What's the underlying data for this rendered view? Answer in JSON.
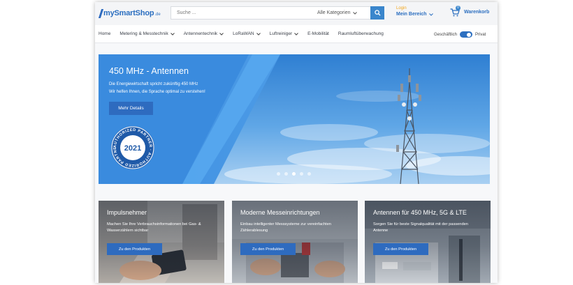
{
  "header": {
    "logo_text": "mySmartShop",
    "logo_tld": ".de",
    "search_placeholder": "Suche ...",
    "category_label": "Alle Kategorien",
    "login_label": "Login",
    "account_label": "Mein Bereich",
    "cart_label": "Warenkorb",
    "cart_count": "0"
  },
  "nav": {
    "items": [
      {
        "label": "Home",
        "dropdown": false
      },
      {
        "label": "Metering & Messtechnik",
        "dropdown": true
      },
      {
        "label": "Antennentechnik",
        "dropdown": true
      },
      {
        "label": "LoRaWAN",
        "dropdown": true
      },
      {
        "label": "Luftreiniger",
        "dropdown": true
      },
      {
        "label": "E-Mobilität",
        "dropdown": false
      },
      {
        "label": "Raumluftüberwachung",
        "dropdown": false
      }
    ],
    "toggle_left": "Geschäftlich",
    "toggle_right": "Privat"
  },
  "hero": {
    "title": "450 MHz - Antennen",
    "line1": "Die Energiewirtschaft spricht zukünftig 450 MHz",
    "line2": "Wir helfen Ihnen, die Sprache optimal zu verstehen!",
    "button": "Mehr Details",
    "seal_year": "2021",
    "seal_ring": "AUTHORIZED PARTNER · AUTHORIZED PARTNER",
    "slides": 5,
    "active_slide": 2
  },
  "cards": [
    {
      "title": "Impulsnehmer",
      "desc": "Machen Sie Ihre Verbrauchsinformationen bei Gas- & Wasserzählern sichtbar",
      "button": "Zu den Produkten"
    },
    {
      "title": "Moderne Messeinrichtungen",
      "desc": "Einbau intelligenter Messsysteme zur vereinfachten Zählerablesung",
      "button": "Zu den Produkten"
    },
    {
      "title": "Antennen für 450 MHz, 5G & LTE",
      "desc": "Sorgen Sie für beste Signalqualität mit der passenden Antenne",
      "button": "Zu den Produkten"
    }
  ],
  "colors": {
    "brand": "#2c6fc0",
    "accent": "#3a86cc",
    "login": "#f2a51a"
  }
}
